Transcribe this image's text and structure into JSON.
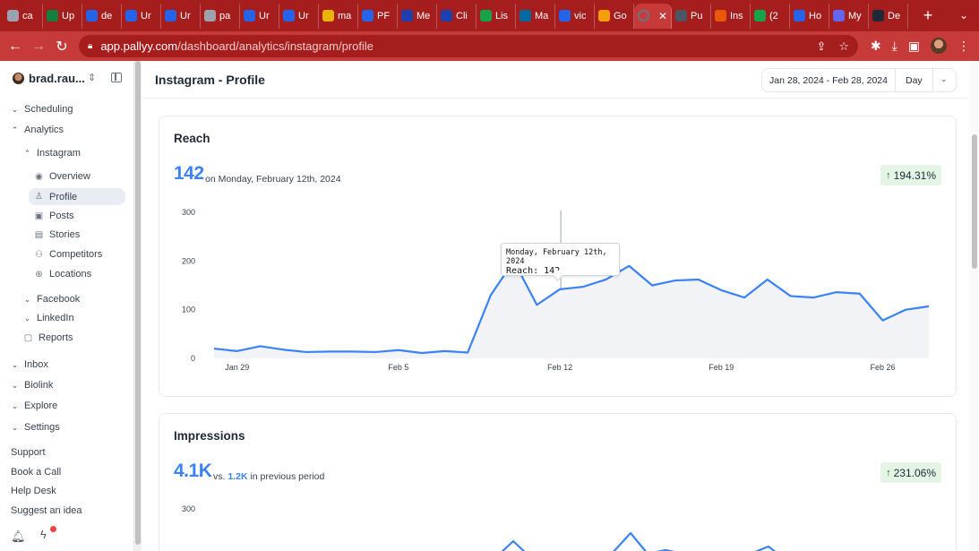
{
  "browser": {
    "tabs": [
      {
        "label": "ca",
        "color": "#9ca3af"
      },
      {
        "label": "Up",
        "color": "#15803d"
      },
      {
        "label": "de",
        "color": "#2563eb"
      },
      {
        "label": "Ur",
        "color": "#2563eb"
      },
      {
        "label": "Ur",
        "color": "#2563eb"
      },
      {
        "label": "pa",
        "color": "#9ca3af"
      },
      {
        "label": "Ur",
        "color": "#2563eb"
      },
      {
        "label": "Ur",
        "color": "#2563eb"
      },
      {
        "label": "ma",
        "color": "#eab308"
      },
      {
        "label": "PF",
        "color": "#2563eb"
      },
      {
        "label": "Me",
        "color": "#1e40af"
      },
      {
        "label": "Cli",
        "color": "#1e40af"
      },
      {
        "label": "Lis",
        "color": "#16a34a"
      },
      {
        "label": "Ma",
        "color": "#0369a1"
      },
      {
        "label": "vic",
        "color": "#2563eb"
      },
      {
        "label": "Go",
        "color": "#f59e0b"
      },
      {
        "label": "",
        "color": "#6b7280",
        "active": true
      },
      {
        "label": "Pu",
        "color": "#4b5563"
      },
      {
        "label": "Ins",
        "color": "#ea580c"
      },
      {
        "label": "(2",
        "color": "#16a34a"
      },
      {
        "label": "Ho",
        "color": "#2563eb"
      },
      {
        "label": "My",
        "color": "#6366f1"
      },
      {
        "label": "De",
        "color": "#1f2937"
      }
    ],
    "url_host": "app.pallyy.com",
    "url_path": "/dashboard/analytics/instagram/profile",
    "new_tab": "+",
    "close_glyph": "✕"
  },
  "sidebar": {
    "account_name": "brad.rau...",
    "items": [
      {
        "label": "Scheduling",
        "chev": "⌄"
      },
      {
        "label": "Analytics",
        "chev": "⌃"
      },
      {
        "label": "Instagram",
        "chev": "⌃"
      },
      {
        "label": "Overview",
        "icon": "◉"
      },
      {
        "label": "Profile",
        "icon": "♙"
      },
      {
        "label": "Posts",
        "icon": "▣"
      },
      {
        "label": "Stories",
        "icon": "▤"
      },
      {
        "label": "Competitors",
        "icon": "⚇"
      },
      {
        "label": "Locations",
        "icon": "⊕"
      },
      {
        "label": "Facebook",
        "chev": "⌄"
      },
      {
        "label": "LinkedIn",
        "chev": "⌄"
      },
      {
        "label": "Reports",
        "icon": "▢"
      },
      {
        "label": "Inbox",
        "chev": "⌄"
      },
      {
        "label": "Biolink",
        "chev": "⌄"
      },
      {
        "label": "Explore",
        "chev": "⌄"
      },
      {
        "label": "Settings",
        "chev": "⌄"
      }
    ],
    "footer_links": [
      "Support",
      "Book a Call",
      "Help Desk",
      "Suggest an idea"
    ]
  },
  "header": {
    "title": "Instagram - Profile",
    "date_range": "Jan 28, 2024 - Feb 28, 2024",
    "granularity": "Day"
  },
  "reach": {
    "title": "Reach",
    "value": "142",
    "subtitle": "on Monday, February 12th, 2024",
    "change": "194.31%",
    "tooltip_date": "Monday, February 12th, 2024",
    "tooltip_label": "Reach:",
    "tooltip_value": "142"
  },
  "impressions": {
    "title": "Impressions",
    "value": "4.1K",
    "vs_label": "vs.",
    "previous_value": "1.2K",
    "previous_label": "in previous period",
    "change": "231.06%"
  },
  "chart_data": [
    {
      "type": "area",
      "title": "Reach",
      "x_ticks": [
        "Jan 29",
        "Feb 5",
        "Feb 12",
        "Feb 19",
        "Feb 26"
      ],
      "y_ticks": [
        0,
        100,
        200,
        300
      ],
      "ylim": [
        0,
        300
      ],
      "x": [
        "Jan 28",
        "Jan 29",
        "Jan 30",
        "Jan 31",
        "Feb 1",
        "Feb 2",
        "Feb 3",
        "Feb 4",
        "Feb 5",
        "Feb 6",
        "Feb 7",
        "Feb 8",
        "Feb 9",
        "Feb 10",
        "Feb 11",
        "Feb 12",
        "Feb 13",
        "Feb 14",
        "Feb 15",
        "Feb 16",
        "Feb 17",
        "Feb 18",
        "Feb 19",
        "Feb 20",
        "Feb 21",
        "Feb 22",
        "Feb 23",
        "Feb 24",
        "Feb 25",
        "Feb 26",
        "Feb 27",
        "Feb 28"
      ],
      "values": [
        20,
        15,
        25,
        18,
        13,
        14,
        14,
        13,
        17,
        11,
        15,
        12,
        130,
        200,
        110,
        142,
        147,
        162,
        190,
        150,
        160,
        162,
        140,
        125,
        162,
        128,
        125,
        136,
        133,
        78,
        100,
        107
      ],
      "highlight_index": 15,
      "line_color": "#3b82f6",
      "fill_color": "#f1f3f7"
    },
    {
      "type": "line",
      "title": "Impressions",
      "y_ticks": [
        300
      ],
      "ylim": [
        0,
        300
      ],
      "line_color": "#3b82f6"
    }
  ]
}
